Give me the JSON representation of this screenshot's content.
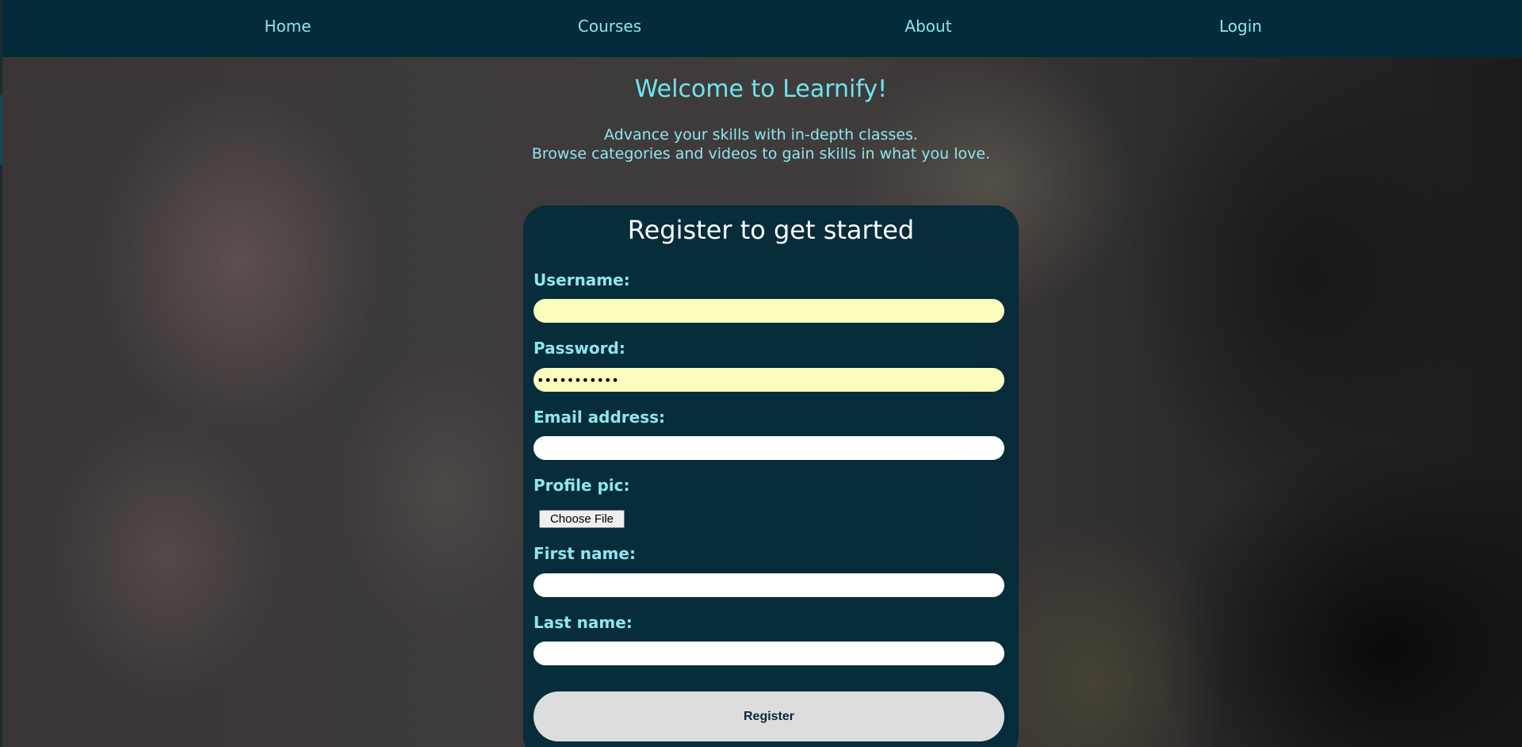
{
  "nav": {
    "home": "Home",
    "courses": "Courses",
    "about": "About",
    "login": "Login"
  },
  "hero": {
    "title": "Welcome to Learnify!",
    "line1": "Advance your skills with in-depth classes.",
    "line2": "Browse categories and videos to gain skills in what you love."
  },
  "register": {
    "title": "Register to get started",
    "username_label": "Username:",
    "username_value": "",
    "password_label": "Password:",
    "password_value": "•••••••••••",
    "email_label": "Email address:",
    "email_value": "",
    "pic_label": "Profile pic:",
    "file_button": "Choose File",
    "first_label": "First name:",
    "first_value": "",
    "last_label": "Last name:",
    "last_value": "",
    "submit_label": "Register"
  },
  "colors": {
    "navbar_bg": "#032b3a",
    "accent_text": "#8fe6ee",
    "autofill_bg": "#fafcbc",
    "button_bg": "#dddddd"
  }
}
